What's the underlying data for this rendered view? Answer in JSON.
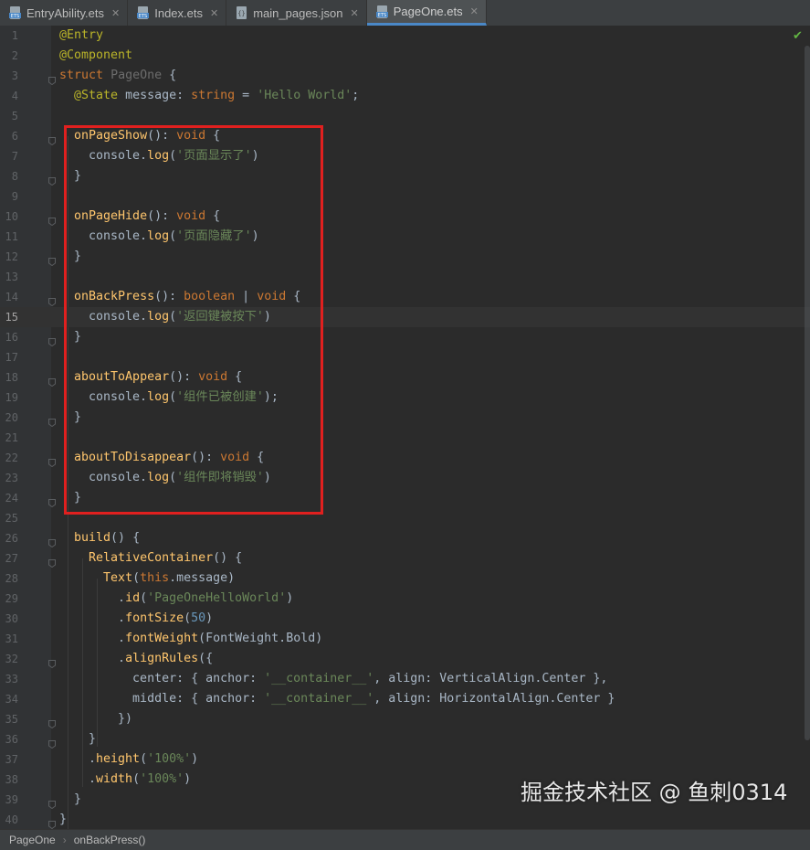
{
  "tabs": [
    {
      "label": "EntryAbility.ets",
      "icon": "ets-file-icon",
      "active": false
    },
    {
      "label": "Index.ets",
      "icon": "ets-file-icon",
      "active": false
    },
    {
      "label": "main_pages.json",
      "icon": "json-file-icon",
      "active": false
    },
    {
      "label": "PageOne.ets",
      "icon": "ets-file-icon",
      "active": true
    }
  ],
  "code_lines": [
    "@Entry",
    "@Component",
    "struct PageOne {",
    "  @State message: string = 'Hello World';",
    "",
    "  onPageShow(): void {",
    "    console.log('页面显示了')",
    "  }",
    "",
    "  onPageHide(): void {",
    "    console.log('页面隐藏了')",
    "  }",
    "",
    "  onBackPress(): boolean | void {",
    "    console.log('返回键被按下')",
    "  }",
    "",
    "  aboutToAppear(): void {",
    "    console.log('组件已被创建');",
    "  }",
    "",
    "  aboutToDisappear(): void {",
    "    console.log('组件即将销毁')",
    "  }",
    "",
    "  build() {",
    "    RelativeContainer() {",
    "      Text(this.message)",
    "        .id('PageOneHelloWorld')",
    "        .fontSize(50)",
    "        .fontWeight(FontWeight.Bold)",
    "        .alignRules({",
    "          center: { anchor: '__container__', align: VerticalAlign.Center },",
    "          middle: { anchor: '__container__', align: HorizontalAlign.Center }",
    "        })",
    "    }",
    "    .height('100%')",
    "    .width('100%')",
    "  }",
    "}"
  ],
  "current_line": 15,
  "inspection_status_icon": "check-icon",
  "watermark": "掘金技术社区 @ 鱼刺0314",
  "breadcrumb": {
    "items": [
      "PageOne",
      "onBackPress()"
    ]
  },
  "colors": {
    "accent": "#4a88c7",
    "highlight_box": "#e0201f",
    "background": "#2b2b2b"
  }
}
